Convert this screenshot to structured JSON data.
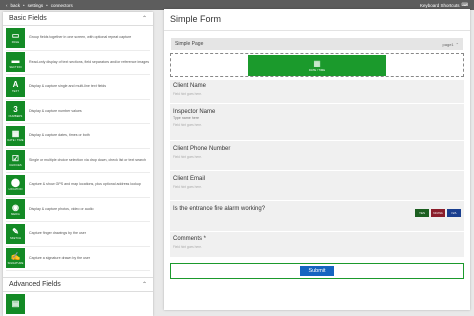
{
  "topbar": {
    "back": "back",
    "settings": "settings",
    "connectors": "connectors",
    "shortcuts": "Keyboard Shortcuts"
  },
  "left": {
    "basic_title": "Basic Fields",
    "items": [
      {
        "name": "PAGE",
        "glyph": "▭",
        "desc": "Group fields together in one screen, with optional repeat capture"
      },
      {
        "name": "SECTION",
        "glyph": "▬",
        "desc": "Read-only display of text sections, field separators and/or reference images"
      },
      {
        "name": "TEXT",
        "glyph": "A",
        "desc": "Display & capture single and multi-line text fields"
      },
      {
        "name": "NUMBERS",
        "glyph": "3",
        "desc": "Display & capture number values"
      },
      {
        "name": "DATE / TIME",
        "glyph": "▦",
        "desc": "Display & capture dates, times or both"
      },
      {
        "name": "CHOICES",
        "glyph": "☑",
        "desc": "Single or multiple choice selection via drop down, check list or text search"
      },
      {
        "name": "LOCATION",
        "glyph": "⬤",
        "desc": "Capture & show GPS and map locations, plus optional address lookup"
      },
      {
        "name": "MEDIA",
        "glyph": "◉",
        "desc": "Display & capture photos, video or audio"
      },
      {
        "name": "SKETCH",
        "glyph": "✎",
        "desc": "Capture finger drawings by the user"
      },
      {
        "name": "SIGNATURE",
        "glyph": "✍",
        "desc": "Capture a signature drawn by the user"
      }
    ],
    "advanced_title": "Advanced Fields",
    "adv_first_name": "",
    "adv_first_desc": ""
  },
  "form": {
    "title": "Simple Form",
    "page_label": "Simple Page",
    "page_tag": "page1",
    "date_tile": "DATE / TIME",
    "hint": "Field hint goes here.",
    "fields": [
      {
        "label": "Client Name",
        "sub": "",
        "hint": "Field hint goes here."
      },
      {
        "label": "Inspector Name",
        "sub": "Type name here",
        "hint": "Field hint goes here."
      },
      {
        "label": "Client Phone Number",
        "sub": "",
        "hint": "Field hint goes here."
      },
      {
        "label": "Client Email",
        "sub": "",
        "hint": "Field hint goes here."
      }
    ],
    "question": "Is the entrance fire alarm working?",
    "choices": [
      {
        "label": "YES",
        "color": "#1b5e20"
      },
      {
        "label": "NO/NA",
        "color": "#8b1e2b"
      },
      {
        "label": "N/A",
        "color": "#1a3f8f"
      }
    ],
    "comments_label": "Comments *",
    "comments_hint": "Field hint goes here.",
    "submit": "Submit"
  }
}
